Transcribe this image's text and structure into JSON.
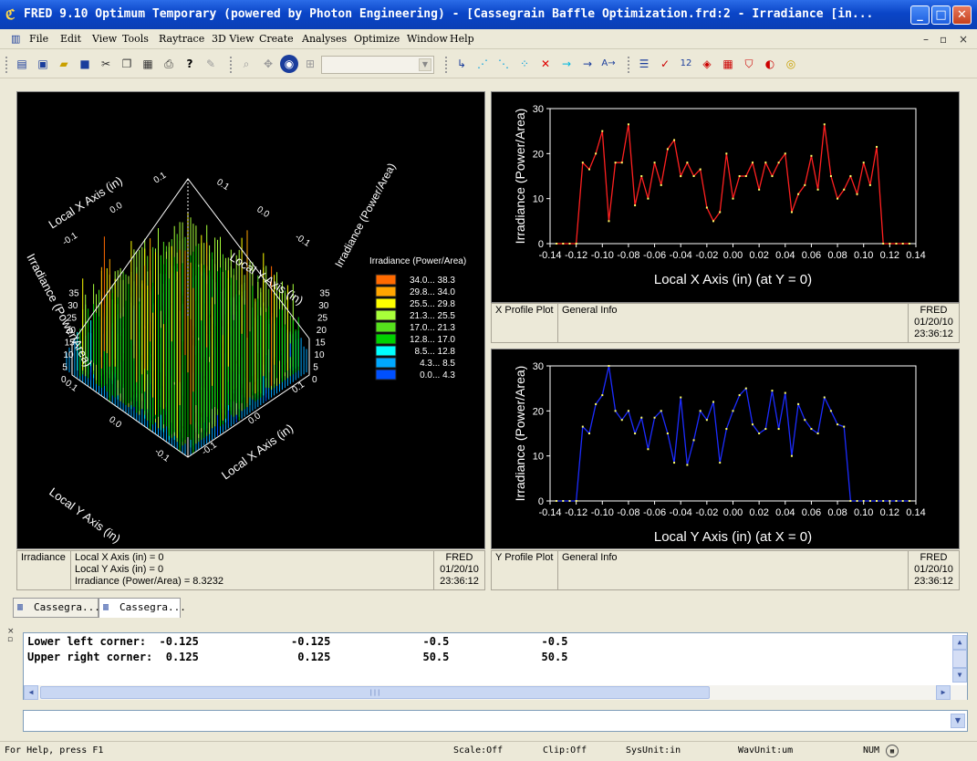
{
  "window": {
    "title": "FRED 9.10 Optimum Temporary (powered by Photon Engineering) - [Cassegrain Baffle Optimization.frd:2 - Irradiance  [in...",
    "minimize": "_",
    "maximize": "□",
    "close": "✕"
  },
  "menu": {
    "items": [
      "File",
      "Edit",
      "View",
      "Tools",
      "Raytrace",
      "3D View",
      "Create",
      "Analyses",
      "Optimize",
      "Window",
      "Help"
    ],
    "mdi_controls": [
      "–",
      "▫",
      "×"
    ]
  },
  "toolbar": {
    "combo_value": "",
    "icons": [
      "new-document-icon",
      "new-project-icon",
      "open-folder-icon",
      "save-icon",
      "cut-icon",
      "copy-icon",
      "paste-icon",
      "print-icon",
      "help-icon",
      "edit-icon",
      "zoom-icon",
      "pan-icon",
      "globe-icon",
      "fit-icon",
      "trace-icon",
      "rays-icon",
      "rays2-icon",
      "rays3-icon",
      "stop-icon",
      "arrow-cyan-icon",
      "arrow-blue-icon",
      "arrow-text-icon",
      "list-icon",
      "check-icon",
      "number-icon",
      "cube-icon",
      "grid-icon",
      "filter-icon",
      "lens-icon",
      "target-icon"
    ]
  },
  "surface_plot": {
    "legend_title": "Irradiance (Power/Area)",
    "legend": [
      {
        "label": "34.0... 38.3",
        "color": "#ff6a00"
      },
      {
        "label": "29.8... 34.0",
        "color": "#ffa500"
      },
      {
        "label": "25.5... 29.8",
        "color": "#ffff00"
      },
      {
        "label": "21.3... 25.5",
        "color": "#a8ff3a"
      },
      {
        "label": "17.0... 21.3",
        "color": "#55e01c"
      },
      {
        "label": "12.8... 17.0",
        "color": "#00d000"
      },
      {
        "label": "8.5... 12.8",
        "color": "#00ffff"
      },
      {
        "label": "4.3... 8.5",
        "color": "#00a8ff"
      },
      {
        "label": "0.0... 4.3",
        "color": "#0050ff"
      }
    ],
    "labels": {
      "x_axis_top": "Local X Axis (in)",
      "y_axis_top": "Local Y Axis (in)",
      "z_left": "Irradiance (Power/Area)",
      "z_right": "Irradiance (Power/Area)",
      "y_axis_bottom": "Local Y Axis (in)",
      "x_axis_bottom": "Local X Axis (in)",
      "tick_neg": "-0.1",
      "tick_zero": "0.0",
      "tick_pos": "0.1",
      "z_ticks": [
        "0",
        "5",
        "10",
        "15",
        "20",
        "25",
        "30",
        "35"
      ]
    },
    "footer": {
      "name": "Irradiance",
      "info": [
        "Local X Axis (in) = 0",
        "Local Y Axis (in) = 0",
        "Irradiance (Power/Area) = 8.3232"
      ],
      "app": "FRED",
      "date": "01/20/10",
      "time": "23:36:12"
    }
  },
  "chart_data": [
    {
      "type": "line",
      "name": "X Profile Plot",
      "xlabel": "Local X Axis (in) (at Y = 0)",
      "ylabel": "Irradiance (Power/Area)",
      "xlim": [
        -0.14,
        0.14
      ],
      "ylim": [
        0,
        30
      ],
      "xticks": [
        "-0.14",
        "-0.12",
        "-0.10",
        "-0.08",
        "-0.06",
        "-0.04",
        "-0.02",
        "0.00",
        "0.02",
        "0.04",
        "0.06",
        "0.08",
        "0.10",
        "0.12",
        "0.14"
      ],
      "yticks": [
        "0",
        "10",
        "20",
        "30"
      ],
      "color": "#ff2020",
      "x": [
        -0.135,
        -0.13,
        -0.125,
        -0.12,
        -0.115,
        -0.11,
        -0.105,
        -0.1,
        -0.095,
        -0.09,
        -0.085,
        -0.08,
        -0.075,
        -0.07,
        -0.065,
        -0.06,
        -0.055,
        -0.05,
        -0.045,
        -0.04,
        -0.035,
        -0.03,
        -0.025,
        -0.02,
        -0.015,
        -0.01,
        -0.005,
        0.0,
        0.005,
        0.01,
        0.015,
        0.02,
        0.025,
        0.03,
        0.035,
        0.04,
        0.045,
        0.05,
        0.055,
        0.06,
        0.065,
        0.07,
        0.075,
        0.08,
        0.085,
        0.09,
        0.095,
        0.1,
        0.105,
        0.11,
        0.115,
        0.12,
        0.125,
        0.13,
        0.135
      ],
      "y": [
        0,
        0,
        0,
        0,
        18,
        16.5,
        20,
        25,
        5,
        18,
        18,
        26.5,
        8.5,
        15,
        10,
        18,
        13,
        21,
        23,
        15,
        18,
        15,
        16.5,
        8,
        5,
        7,
        20,
        10,
        15,
        15,
        18,
        12,
        18,
        15,
        18,
        20,
        7,
        11,
        13,
        19.5,
        12,
        26.5,
        15,
        10,
        12,
        15,
        11,
        18,
        13,
        21.5,
        0,
        0,
        0,
        0,
        0
      ]
    },
    {
      "type": "line",
      "name": "Y Profile Plot",
      "xlabel": "Local Y Axis (in) (at X = 0)",
      "ylabel": "Irradiance (Power/Area)",
      "xlim": [
        -0.14,
        0.14
      ],
      "ylim": [
        0,
        30
      ],
      "xticks": [
        "-0.14",
        "-0.12",
        "-0.10",
        "-0.08",
        "-0.06",
        "-0.04",
        "-0.02",
        "0.00",
        "0.02",
        "0.04",
        "0.06",
        "0.08",
        "0.10",
        "0.12",
        "0.14"
      ],
      "yticks": [
        "0",
        "10",
        "20",
        "30"
      ],
      "color": "#1c2cff",
      "x": [
        -0.135,
        -0.13,
        -0.125,
        -0.12,
        -0.115,
        -0.11,
        -0.105,
        -0.1,
        -0.095,
        -0.09,
        -0.085,
        -0.08,
        -0.075,
        -0.07,
        -0.065,
        -0.06,
        -0.055,
        -0.05,
        -0.045,
        -0.04,
        -0.035,
        -0.03,
        -0.025,
        -0.02,
        -0.015,
        -0.01,
        -0.005,
        0.0,
        0.005,
        0.01,
        0.015,
        0.02,
        0.025,
        0.03,
        0.035,
        0.04,
        0.045,
        0.05,
        0.055,
        0.06,
        0.065,
        0.07,
        0.075,
        0.08,
        0.085,
        0.09,
        0.095,
        0.1,
        0.105,
        0.11,
        0.115,
        0.12,
        0.125,
        0.13,
        0.135
      ],
      "y": [
        0,
        0,
        0,
        0,
        16.5,
        15,
        21.5,
        23.5,
        30,
        20,
        18,
        20,
        15,
        18.5,
        11.5,
        18.5,
        20,
        15,
        8.5,
        23,
        8,
        13.5,
        20,
        18,
        22,
        8.5,
        16,
        20,
        23.5,
        25,
        17,
        15,
        16,
        24.5,
        16,
        24,
        10,
        21.5,
        18,
        16,
        15,
        23,
        20,
        17,
        16.5,
        0,
        0,
        0,
        0,
        0,
        0,
        0,
        0,
        0,
        0
      ]
    }
  ],
  "xprofile_footer": {
    "name": "X Profile Plot",
    "info": "General Info",
    "app": "FRED",
    "date": "01/20/10",
    "time": "23:36:12"
  },
  "yprofile_footer": {
    "name": "Y Profile Plot",
    "info": "General Info",
    "app": "FRED",
    "date": "01/20/10",
    "time": "23:36:12"
  },
  "tabs": [
    "Cassegra...",
    "Cassegra..."
  ],
  "output": {
    "lines": [
      "Lower left corner:  -0.125              -0.125              -0.5              -0.5",
      "Upper right corner:  0.125               0.125              50.5              50.5"
    ]
  },
  "status": {
    "help": "For Help, press F1",
    "scale": "Scale:Off",
    "clip": "Clip:Off",
    "sysunit": "SysUnit:in",
    "wavunit": "WavUnit:um",
    "num": "NUM"
  }
}
